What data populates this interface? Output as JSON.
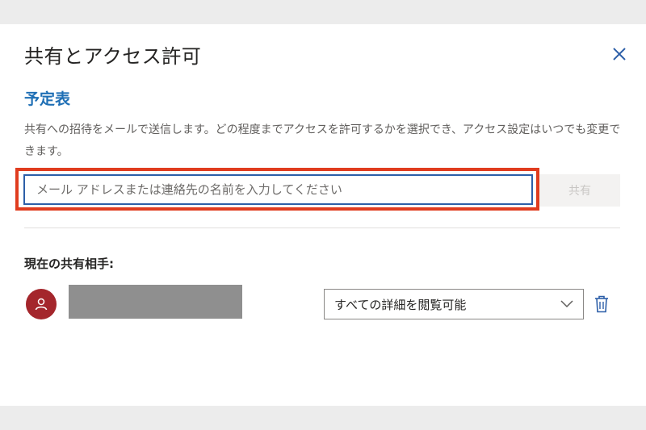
{
  "dialog": {
    "title": "共有とアクセス許可",
    "close_icon": "close-icon"
  },
  "calendar": {
    "name": "予定表",
    "description": "共有への招待をメールで送信します。どの程度までアクセスを許可するかを選択でき、アクセス設定はいつでも変更できます。"
  },
  "invite": {
    "placeholder": "メール アドレスまたは連絡先の名前を入力してください",
    "value": "",
    "share_label": "共有"
  },
  "shared_with": {
    "heading": "現在の共有相手:",
    "people": [
      {
        "avatar_icon": "person-icon",
        "avatar_color": "#a4262c",
        "permission": "すべての詳細を閲覧可能",
        "delete_icon": "trash-icon"
      }
    ]
  },
  "colors": {
    "accent": "#1f6fb5",
    "highlight": "#e03c1f",
    "input_border": "#2d5fa8"
  }
}
